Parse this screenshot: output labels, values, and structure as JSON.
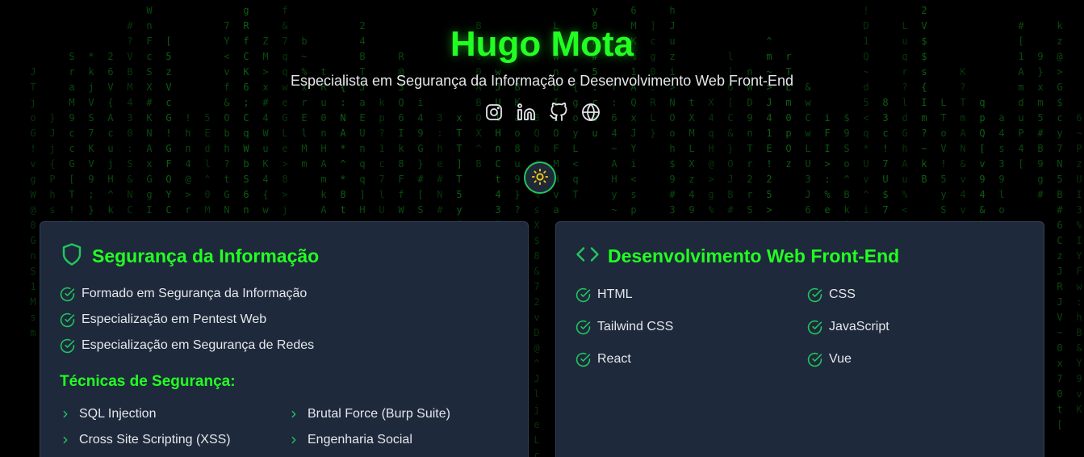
{
  "header": {
    "name": "Hugo Mota",
    "tagline": "Especialista em Segurança da Informação e Desenvolvimento Web Front-End"
  },
  "socials": [
    {
      "icon": "instagram-icon"
    },
    {
      "icon": "linkedin-icon"
    },
    {
      "icon": "github-icon"
    },
    {
      "icon": "globe-icon"
    }
  ],
  "theme_toggle": {
    "icon": "sun-icon"
  },
  "security_card": {
    "title": "Segurança da Informação",
    "icon": "shield-icon",
    "items": [
      "Formado em Segurança da Informação",
      "Especialização em Pentest Web",
      "Especialização em Segurança de Redes"
    ],
    "techniques_title": "Técnicas de Segurança:",
    "techniques": [
      "SQL Injection",
      "Brutal Force (Burp Suite)",
      "Cross Site Scripting (XSS)",
      "Engenharia Social"
    ]
  },
  "frontend_card": {
    "title": "Desenvolvimento Web Front-End",
    "icon": "code-icon",
    "skills": [
      "HTML",
      "CSS",
      "Tailwind CSS",
      "JavaScript",
      "React",
      "Vue"
    ]
  },
  "colors": {
    "accent": "#22ff22",
    "check": "#22c55e",
    "card_bg": "#1e293b",
    "background": "#000000",
    "text": "#e5e7eb",
    "sun": "#facc15"
  }
}
